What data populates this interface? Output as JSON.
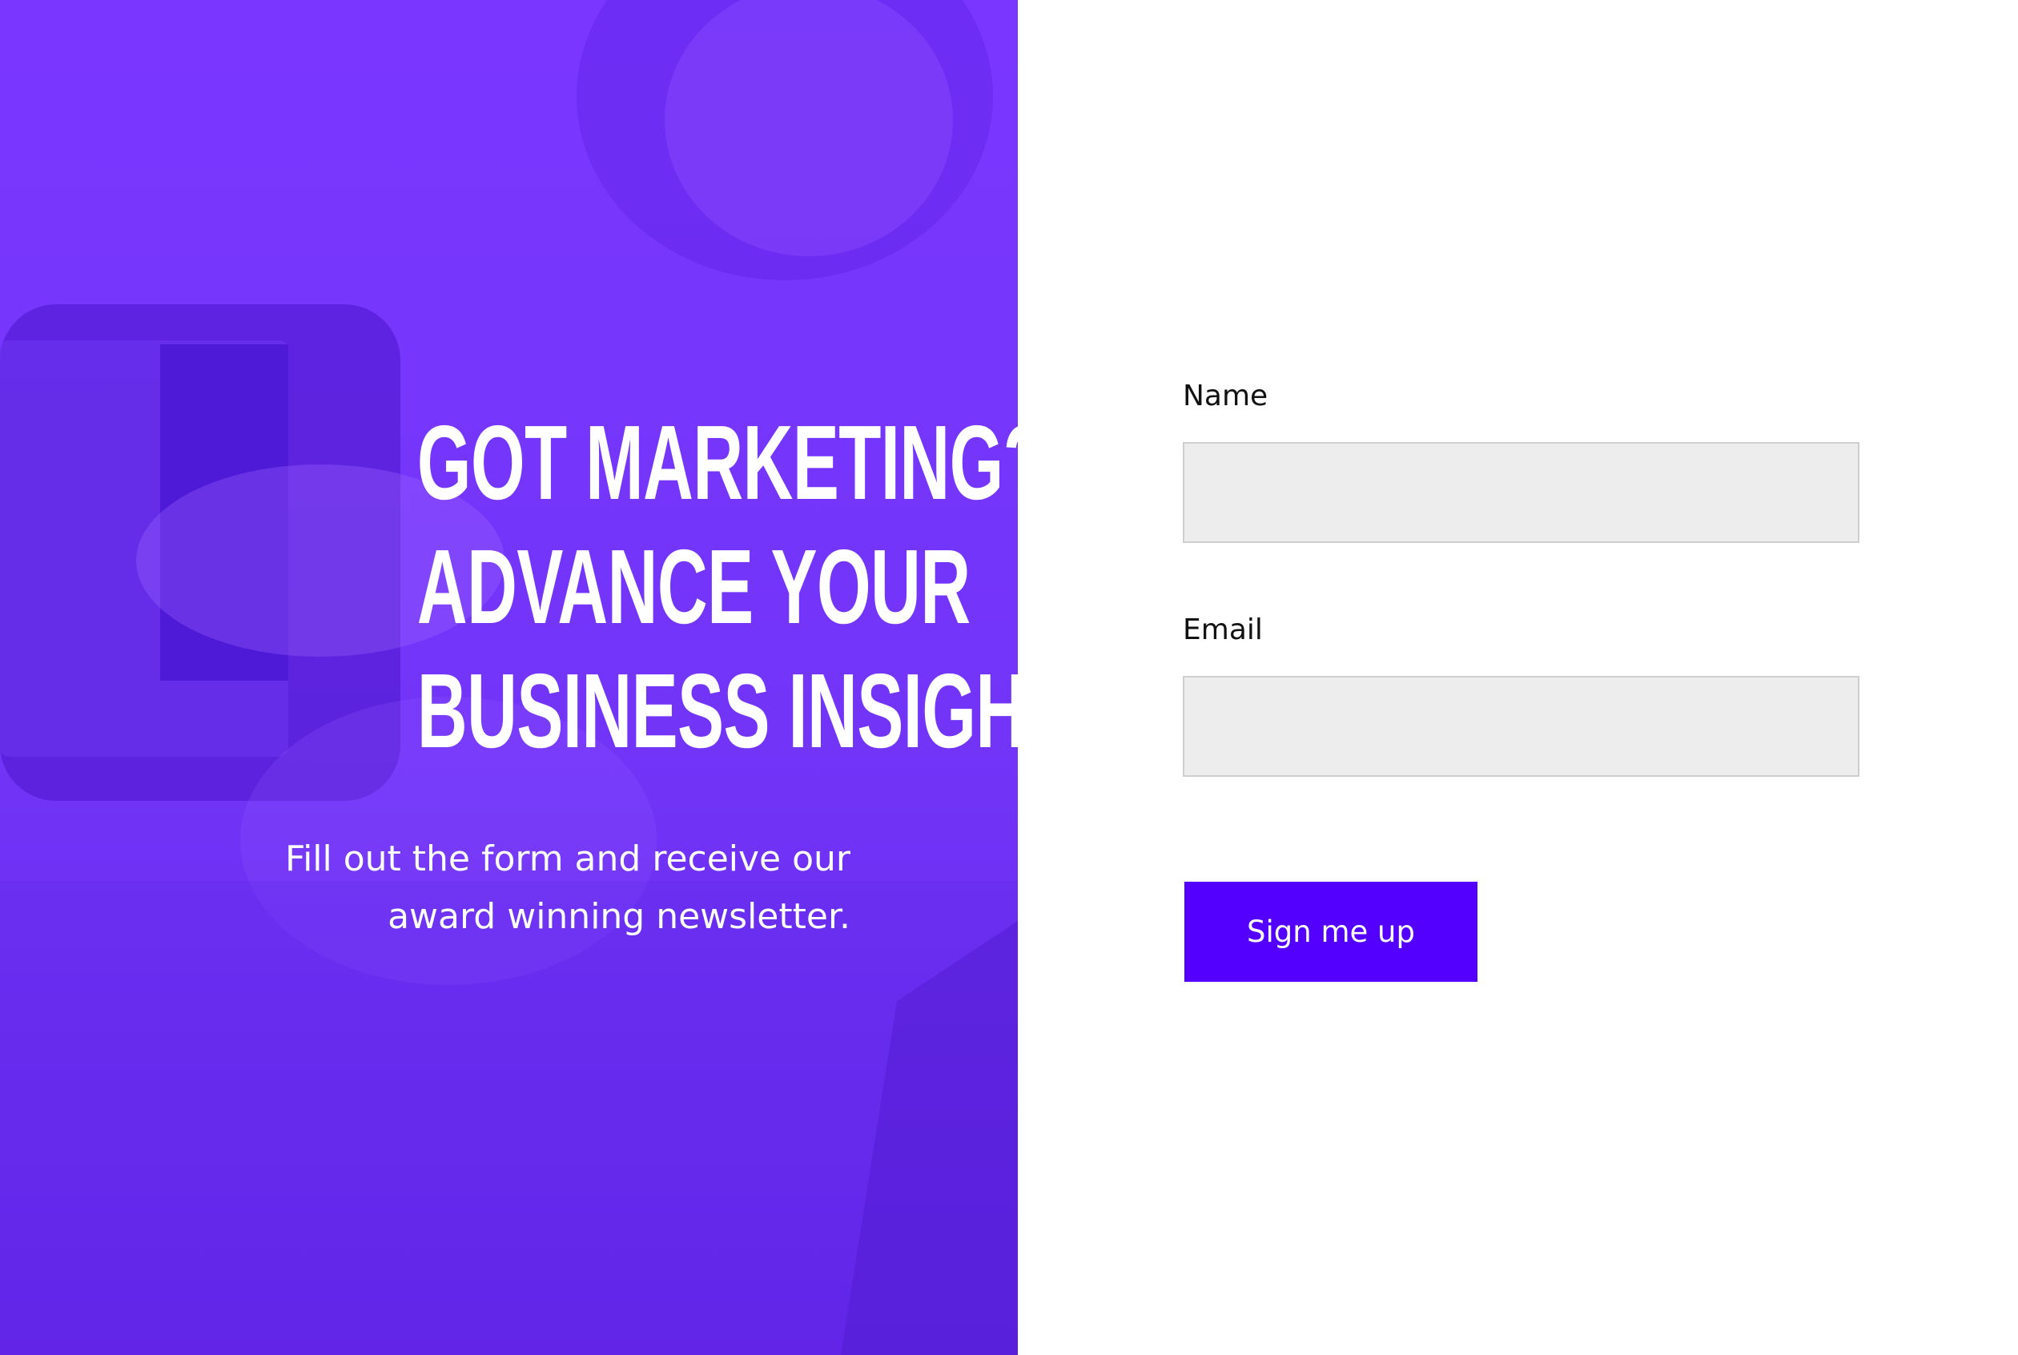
{
  "hero": {
    "headline_lines": [
      "Got marketing?",
      "Advance your",
      "business insight."
    ],
    "subline_lines": [
      "Fill out the form and receive our",
      "award winning newsletter."
    ]
  },
  "form": {
    "name_label": "Name",
    "name_value": "",
    "email_label": "Email",
    "email_value": "",
    "submit_label": "Sign me up"
  },
  "colors": {
    "hero_purple": "#7a36ff",
    "button_accent": "#5300ff",
    "input_background": "#ededed"
  },
  "icons": {
    "background_photo": "hand-holding-phone-photo"
  }
}
